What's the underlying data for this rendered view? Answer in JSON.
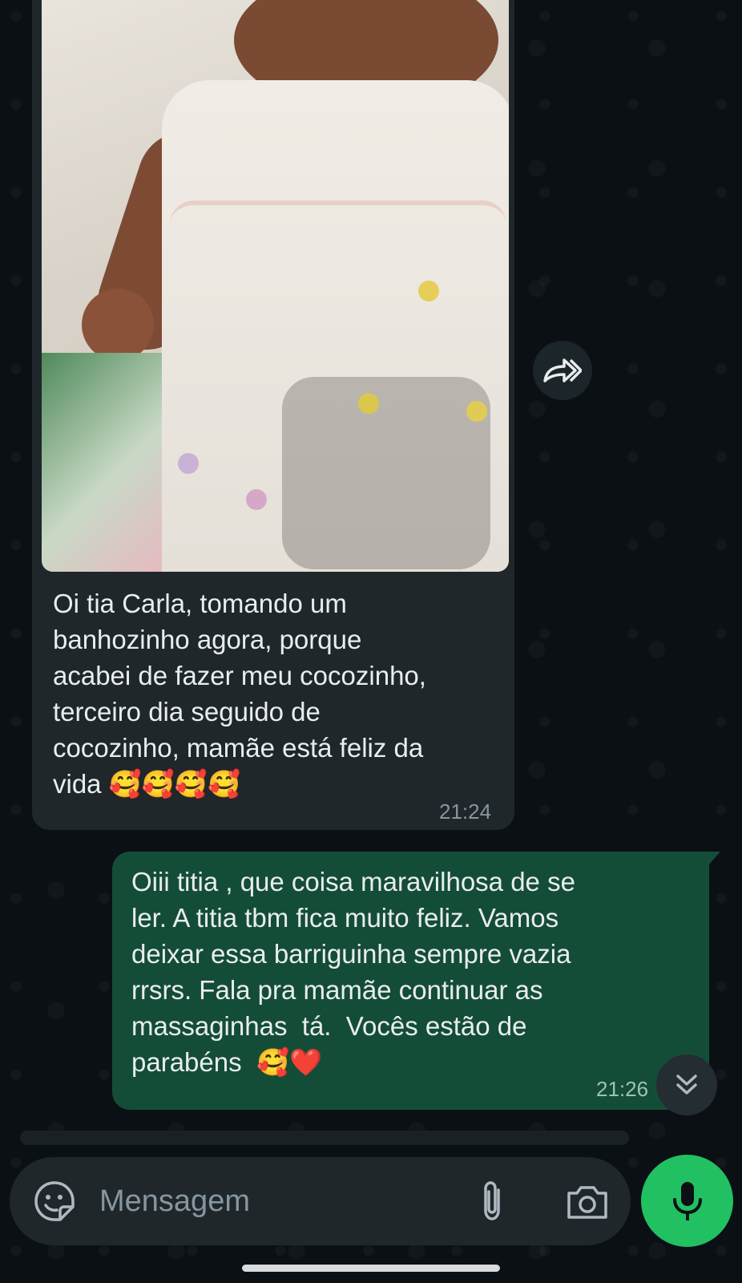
{
  "chat": {
    "incoming": {
      "text": "Oi tia Carla, tomando um\nbanhozinho agora, porque\nacabei de fazer meu cocozinho,\nterceiro dia seguido de\ncocozinho, mamãe está feliz da\nvida 🥰🥰🥰🥰",
      "time": "21:24",
      "photo_icon": "baby-photo"
    },
    "outgoing": {
      "text": "Oiii titia , que coisa maravilhosa de se\nler. A titia tbm fica muito feliz. Vamos\ndeixar essa barriguinha sempre vazia\nrrsrs. Fala pra mamãe continuar as\nmassaginhas  tá.  Vocês estão de\nparabéns  🥰❤️",
      "time": "21:26"
    }
  },
  "composer": {
    "placeholder": "Mensagem",
    "icons": [
      "sticker-icon",
      "attach-clip-icon",
      "camera-icon",
      "mic-icon"
    ]
  },
  "colors": {
    "background": "#0b1014",
    "incoming_bubble": "#1f272a",
    "outgoing_bubble": "#144d37",
    "mic_button": "#21c063"
  }
}
